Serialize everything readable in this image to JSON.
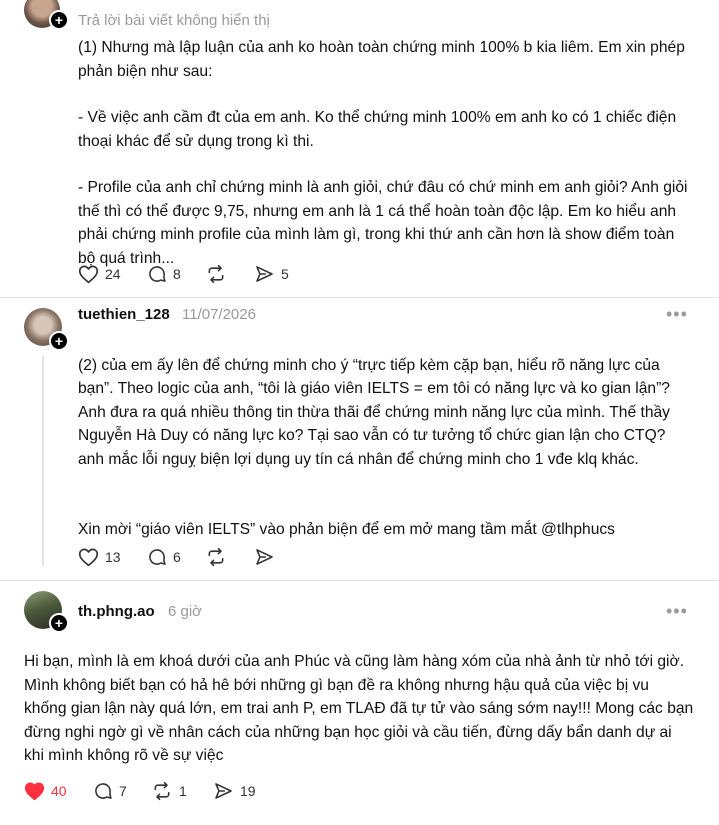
{
  "top_reply": {
    "notice": "Trả lời bài viết không hiển thị",
    "paragraphs": [
      "(1) Nhưng mà lập luận của anh ko hoàn toàn chứng minh 100% b kia liêm. Em xin phép phản biện như sau:",
      "- Về việc anh cầm đt của em anh. Ko thể chứng minh 100% em anh ko có 1 chiếc điện thoại khác để sử dụng trong kì thi.",
      "- Profile của anh chỉ chứng minh là anh giỏi, chứ đâu có chứ minh em anh giỏi? Anh giỏi thế thì có thể được 9,75, nhưng em anh là 1 cá thể hoàn toàn độc lập. Em ko hiểu anh phải chứng minh profile của mình làm gì, trong khi thứ anh cần hơn là show điểm toàn bộ quá trình..."
    ],
    "likes": "24",
    "replies": "8",
    "reposts": "",
    "shares": "5"
  },
  "second_reply": {
    "username": "tuethien_128",
    "time": "11/07/2026",
    "more": "•••",
    "paragraphs": [
      "(2) của em ấy lên để chứng minh cho ý “trực tiếp kèm cặp bạn, hiểu rõ năng lực của bạn”. Theo logic của anh, “tôi là giáo viên IELTS = em tôi có năng lực và ko gian lận”?\nAnh đưa ra quá nhiều thông tin thừa thãi để chứng minh năng lực của mình. Thế thầy Nguyễn Hà Duy có năng lực ko? Tại sao vẫn có tư tưởng tổ chức gian lận cho CTQ? anh mắc lỗi nguỵ biện lợi dụng uy tín cá nhân để chứng minh cho 1 vđe klq khác.",
      "Xin mời “giáo viên IELTS” vào phản biện để em mở mang tầm mắt @tlhphucs"
    ],
    "likes": "13",
    "replies": "6",
    "shares": ""
  },
  "third_reply": {
    "username": "th.phng.ao",
    "time": "6 giờ",
    "more": "•••",
    "paragraphs": [
      "Hi bạn, mình là em khoá dưới của anh Phúc và cũng làm hàng xóm của nhà ảnh từ nhỏ tới giờ. Mình không biết bạn có hả hê bới những gì bạn đề ra không nhưng hậu quả của việc bị vu khống gian lận này quá lớn, em trai anh P, em TLAĐ đã tự tử vào sáng sớm nay!!! Mong các bạn đừng nghi ngờ gì về nhân cách của những bạn học giỏi và cầu tiến, đừng dấy bẩn danh dự ai khi mình không rõ về sự việc"
    ],
    "likes": "40",
    "replies": "7",
    "reposts": "1",
    "shares": "19",
    "liked": true
  },
  "colors": {
    "like_active": "#ff3040",
    "muted": "#9a9a9a",
    "text": "#111111"
  },
  "icons": [
    "heart-icon",
    "comment-icon",
    "repost-icon",
    "share-icon",
    "plus-icon",
    "more-icon"
  ]
}
